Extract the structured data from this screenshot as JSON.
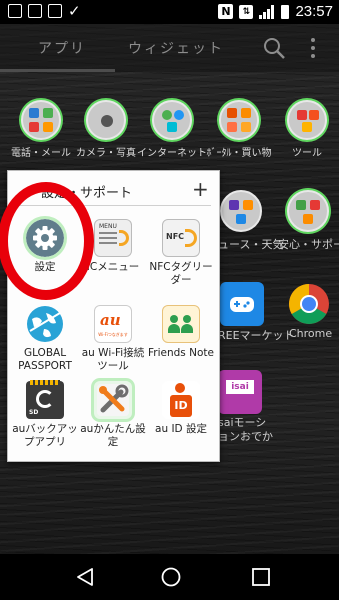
{
  "status_bar": {
    "time": "23:57",
    "nfc_label": "N"
  },
  "tabs": {
    "apps": "アプリ",
    "widgets": "ウィジェット"
  },
  "home_folders": [
    {
      "label": "電話・メール"
    },
    {
      "label": "カメラ・写真"
    },
    {
      "label": "インターネット"
    },
    {
      "label": "ﾎﾞｰﾀﾙ・買い物"
    },
    {
      "label": "ツール"
    }
  ],
  "background_labels": {
    "news": "ュース・天気",
    "safety": "安心・サポート",
    "market": "REEマーケット",
    "chrome": "Chrome",
    "isai1": "saiモーシ",
    "isai2": "ョンおでか"
  },
  "folder": {
    "title": "設定・サポート",
    "apps": [
      {
        "label": "設定",
        "icon": "gear-icon"
      },
      {
        "label": "ICメニュー",
        "icon": "menu-icon"
      },
      {
        "label": "NFCタグリーダー",
        "icon": "nfc-icon"
      },
      {
        "label": "GLOBAL PASSPORT",
        "icon": "globe-icon"
      },
      {
        "label": "au Wi-Fi接続ツール",
        "icon": "au-wifi-icon"
      },
      {
        "label": "Friends Note",
        "icon": "friends-icon"
      },
      {
        "label": "auバックアップアプリ",
        "icon": "sd-backup-icon"
      },
      {
        "label": "auかんたん設定",
        "icon": "tools-icon"
      },
      {
        "label": "au ID 設定",
        "icon": "id-icon"
      }
    ]
  },
  "icon_texts": {
    "nfc": "NFC",
    "au": "au",
    "au_wifi": "Wi-Fiつなぎます",
    "id": "ID",
    "sd": "SD",
    "menu": "MENU"
  },
  "colors": {
    "highlight_ring": "#e8000a",
    "gear_bg": "#607d8b",
    "folder_bg": "#fdfdfd",
    "au_orange": "#e8500a"
  }
}
